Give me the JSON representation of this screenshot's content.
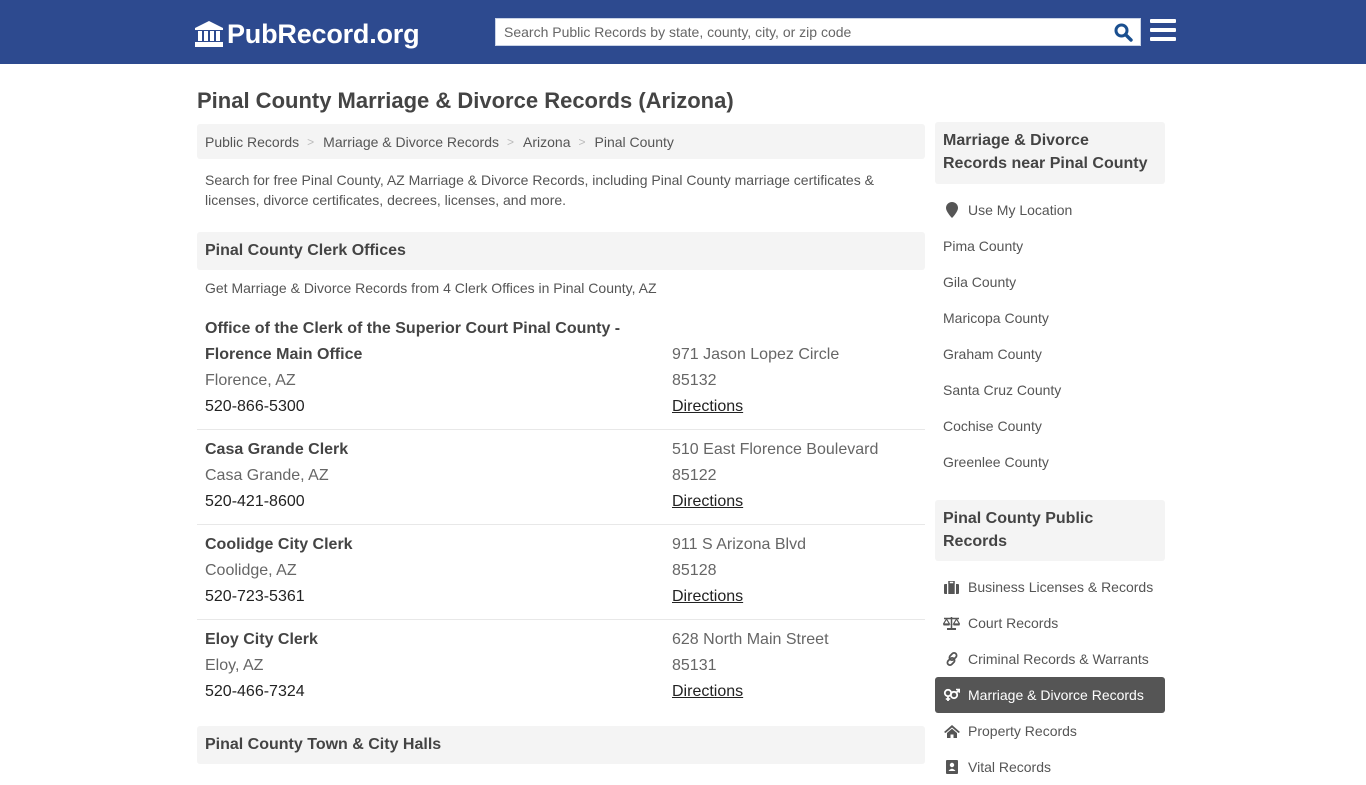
{
  "header": {
    "logo_text": "PubRecord.org",
    "logo_icon": "courthouse-icon",
    "search_placeholder": "Search Public Records by state, county, city, or zip code",
    "search_value": "",
    "search_icon": "search-icon",
    "menu_icon": "hamburger-menu-icon"
  },
  "page": {
    "title": "Pinal County Marriage & Divorce Records (Arizona)",
    "breadcrumb": [
      "Public Records",
      "Marriage & Divorce Records",
      "Arizona",
      "Pinal County"
    ],
    "breadcrumb_separator": ">",
    "intro": "Search for free Pinal County, AZ Marriage & Divorce Records, including Pinal County marriage certificates & licenses, divorce certificates, decrees, licenses, and more."
  },
  "clerk_section": {
    "heading": "Pinal County Clerk Offices",
    "subtext": "Get Marriage & Divorce Records from 4 Clerk Offices in Pinal County, AZ",
    "offices": [
      {
        "name_line1": "Office of the Clerk of the Superior Court Pinal County -",
        "name_line2": "Florence Main Office",
        "city": "Florence, AZ",
        "phone": "520-866-5300",
        "address": "971 Jason Lopez Circle",
        "zip": "85132",
        "directions": "Directions"
      },
      {
        "name_line1": "Casa Grande Clerk",
        "name_line2": "",
        "city": "Casa Grande, AZ",
        "phone": "520-421-8600",
        "address": "510 East Florence Boulevard",
        "zip": "85122",
        "directions": "Directions"
      },
      {
        "name_line1": "Coolidge City Clerk",
        "name_line2": "",
        "city": "Coolidge, AZ",
        "phone": "520-723-5361",
        "address": "911 S Arizona Blvd",
        "zip": "85128",
        "directions": "Directions"
      },
      {
        "name_line1": "Eloy City Clerk",
        "name_line2": "",
        "city": "Eloy, AZ",
        "phone": "520-466-7324",
        "address": "628 North Main Street",
        "zip": "85131",
        "directions": "Directions"
      }
    ]
  },
  "town_section": {
    "heading": "Pinal County Town & City Halls"
  },
  "sidebar": {
    "nearby": {
      "heading": "Marriage & Divorce Records near Pinal County",
      "use_location": "Use My Location",
      "use_location_icon": "map-marker-icon",
      "counties": [
        "Pima County",
        "Gila County",
        "Maricopa County",
        "Graham County",
        "Santa Cruz County",
        "Cochise County",
        "Greenlee County"
      ]
    },
    "public_records": {
      "heading": "Pinal County Public Records",
      "items": [
        {
          "label": "Business Licenses & Records",
          "icon": "briefcase-icon",
          "active": false
        },
        {
          "label": "Court Records",
          "icon": "balance-scale-icon",
          "active": false
        },
        {
          "label": "Criminal Records & Warrants",
          "icon": "link-icon",
          "active": false
        },
        {
          "label": "Marriage & Divorce Records",
          "icon": "gender-symbols-icon",
          "active": true
        },
        {
          "label": "Property Records",
          "icon": "home-icon",
          "active": false
        },
        {
          "label": "Vital Records",
          "icon": "id-card-icon",
          "active": false
        }
      ]
    }
  },
  "colors": {
    "header_bg": "#2d4a8f",
    "search_icon": "#1a4f8f",
    "panel_bg": "#f4f4f4",
    "active_item_bg": "#555555"
  }
}
